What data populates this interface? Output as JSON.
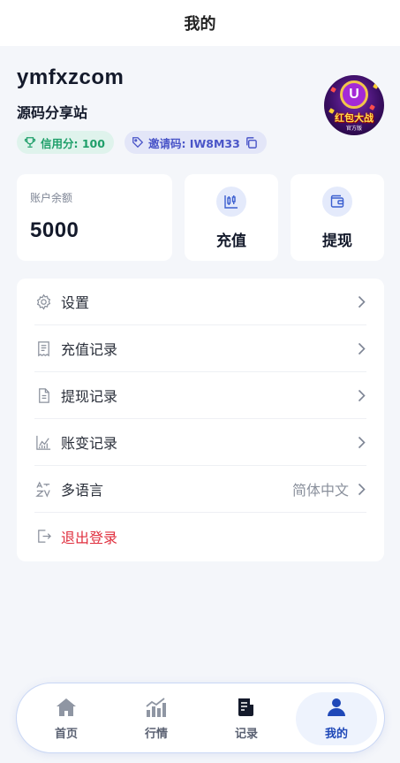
{
  "header": {
    "title": "我的"
  },
  "profile": {
    "username": "ymfxzcom",
    "subtitle": "源码分享站",
    "credit_label": "信用分: 100",
    "invite_label": "邀请码: IW8M33",
    "avatar_text": "红包大战",
    "avatar_sub": "官方版",
    "avatar_letter": "U"
  },
  "balance": {
    "label": "账户余额",
    "value": "5000"
  },
  "actions": {
    "recharge": "充值",
    "withdraw": "提现"
  },
  "menu": {
    "items": [
      {
        "label": "设置",
        "icon": "gear-icon"
      },
      {
        "label": "充值记录",
        "icon": "receipt-icon"
      },
      {
        "label": "提现记录",
        "icon": "document-icon"
      },
      {
        "label": "账变记录",
        "icon": "chart-icon"
      },
      {
        "label": "多语言",
        "icon": "translate-icon",
        "value": "简体中文"
      },
      {
        "label": "退出登录",
        "icon": "logout-icon"
      }
    ]
  },
  "tabs": [
    {
      "label": "首页",
      "icon": "home-icon"
    },
    {
      "label": "行情",
      "icon": "bar-chart-icon"
    },
    {
      "label": "记录",
      "icon": "record-icon"
    },
    {
      "label": "我的",
      "icon": "user-icon"
    }
  ],
  "colors": {
    "accent": "#1f48b8",
    "credit": "#1f9f6a",
    "invite": "#4a55c8",
    "logout": "#e0303f"
  }
}
